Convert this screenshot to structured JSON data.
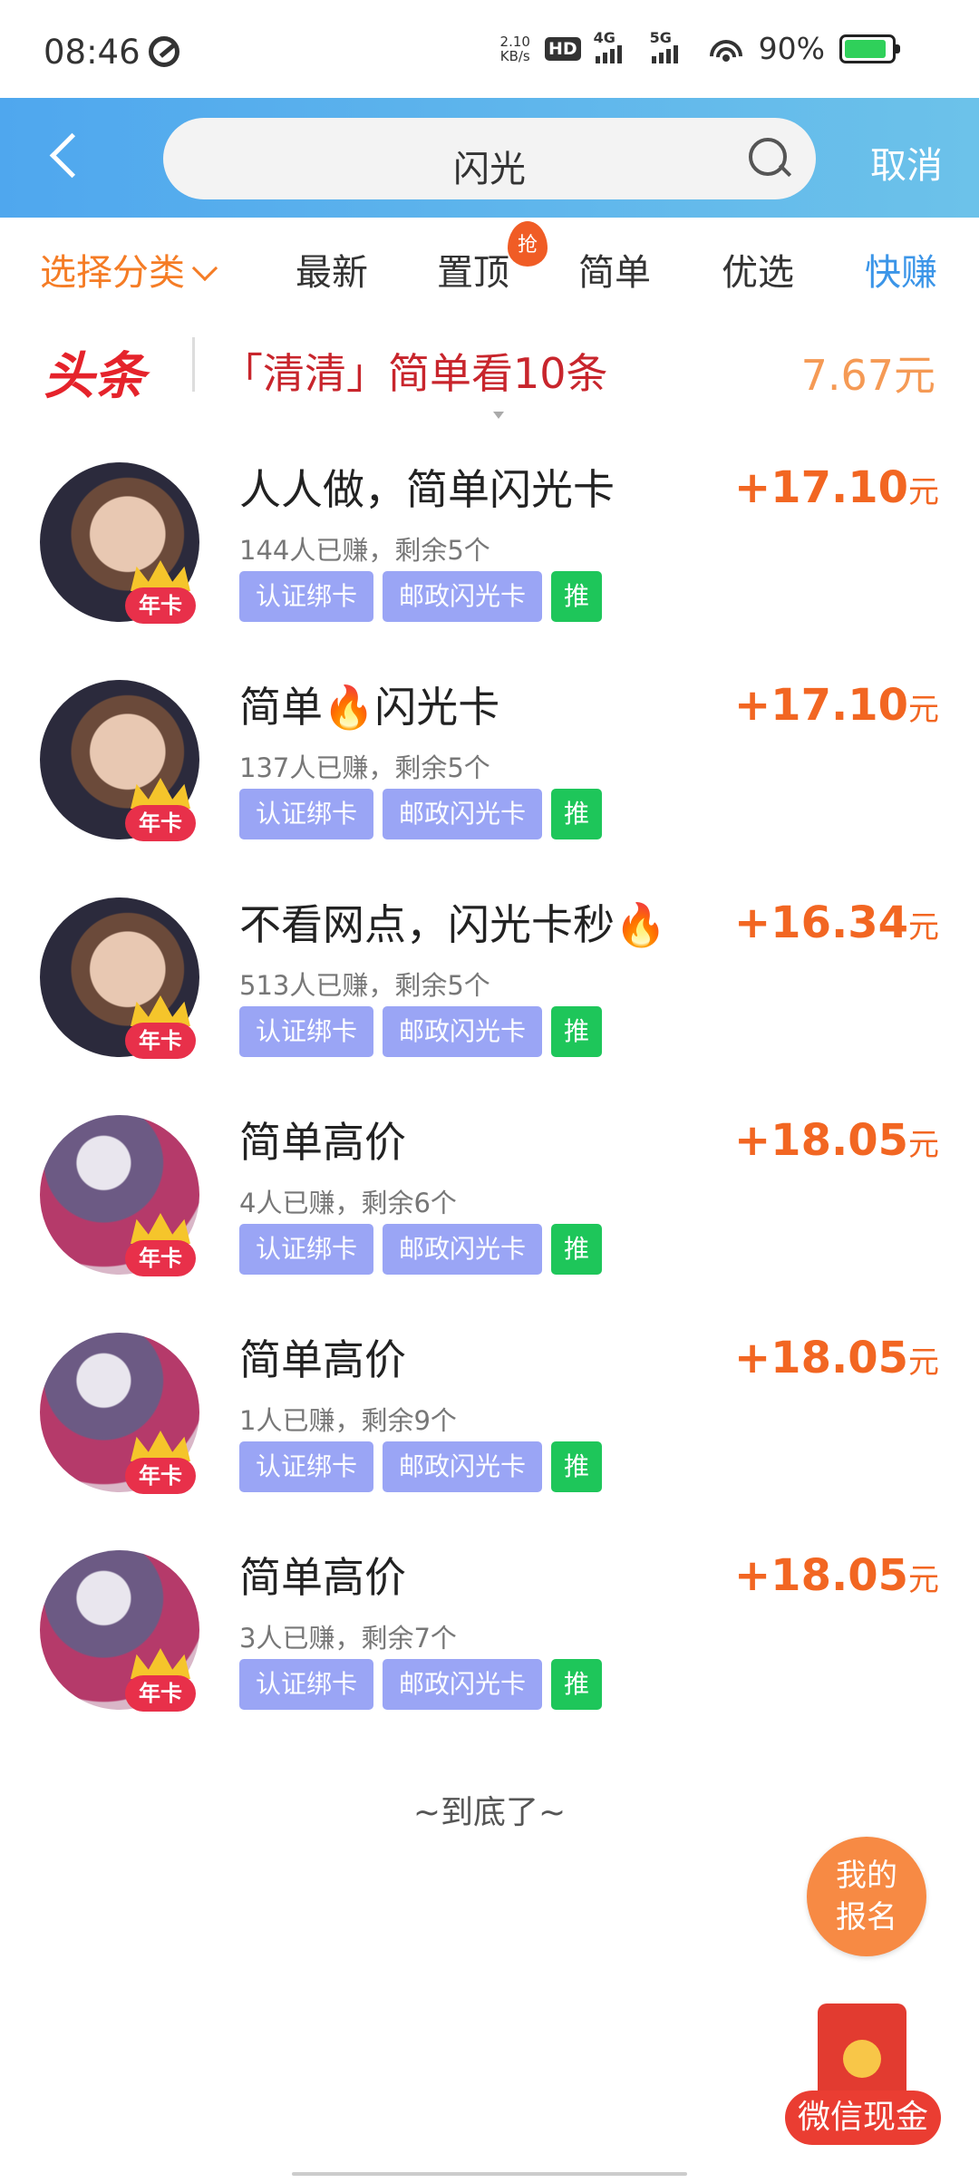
{
  "status_bar": {
    "time": "08:46",
    "net_speed_value": "2.10",
    "net_speed_unit": "KB/s",
    "hd_label": "HD",
    "signal_1": "4G",
    "signal_2": "5G",
    "battery_percent": "90%",
    "battery_level": 0.9,
    "battery_color": "#2fd05a"
  },
  "search": {
    "query": "闪光",
    "cancel_label": "取消"
  },
  "tabs": {
    "category_label": "选择分类",
    "items": [
      "最新",
      "置顶",
      "简单",
      "优选",
      "快赚"
    ],
    "hot_badge": "抢",
    "active_color": "#3b95e8"
  },
  "headline": {
    "logo": "头条",
    "text": "「清清」简单看10条",
    "amount": "7.67元"
  },
  "tasks": [
    {
      "title": "人人做，简单闪光卡",
      "sub": "144人已赚，剩余5个",
      "tags": [
        "认证绑卡",
        "邮政闪光卡",
        "推"
      ],
      "reward": "+17.10",
      "unit": "元",
      "badge": "年卡",
      "avatar": "person-photo"
    },
    {
      "title": "简单🔥闪光卡",
      "sub": "137人已赚，剩余5个",
      "tags": [
        "认证绑卡",
        "邮政闪光卡",
        "推"
      ],
      "reward": "+17.10",
      "unit": "元",
      "badge": "年卡",
      "avatar": "person-photo"
    },
    {
      "title": "不看网点，闪光卡秒🔥",
      "sub": "513人已赚，剩余5个",
      "tags": [
        "认证绑卡",
        "邮政闪光卡",
        "推"
      ],
      "reward": "+16.34",
      "unit": "元",
      "badge": "年卡",
      "avatar": "person-photo"
    },
    {
      "title": "简单高价",
      "sub": "4人已赚，剩余6个",
      "tags": [
        "认证绑卡",
        "邮政闪光卡",
        "推"
      ],
      "reward": "+18.05",
      "unit": "元",
      "badge": "年卡",
      "avatar": "anime-illustration"
    },
    {
      "title": "简单高价",
      "sub": "1人已赚，剩余9个",
      "tags": [
        "认证绑卡",
        "邮政闪光卡",
        "推"
      ],
      "reward": "+18.05",
      "unit": "元",
      "badge": "年卡",
      "avatar": "anime-illustration"
    },
    {
      "title": "简单高价",
      "sub": "3人已赚，剩余7个",
      "tags": [
        "认证绑卡",
        "邮政闪光卡",
        "推"
      ],
      "reward": "+18.05",
      "unit": "元",
      "badge": "年卡",
      "avatar": "anime-illustration"
    }
  ],
  "footer": {
    "end_text": "~到底了~",
    "my_signup": [
      "我的",
      "报名"
    ],
    "wechat_cash": "微信现金"
  },
  "colors": {
    "header_gradient_start": "#4fa7ee",
    "header_gradient_end": "#6cc2ea",
    "reward": "#f26622",
    "tag": "#9aa5f5",
    "push_tag": "#1ec65a",
    "headline_red": "#c8252c"
  }
}
